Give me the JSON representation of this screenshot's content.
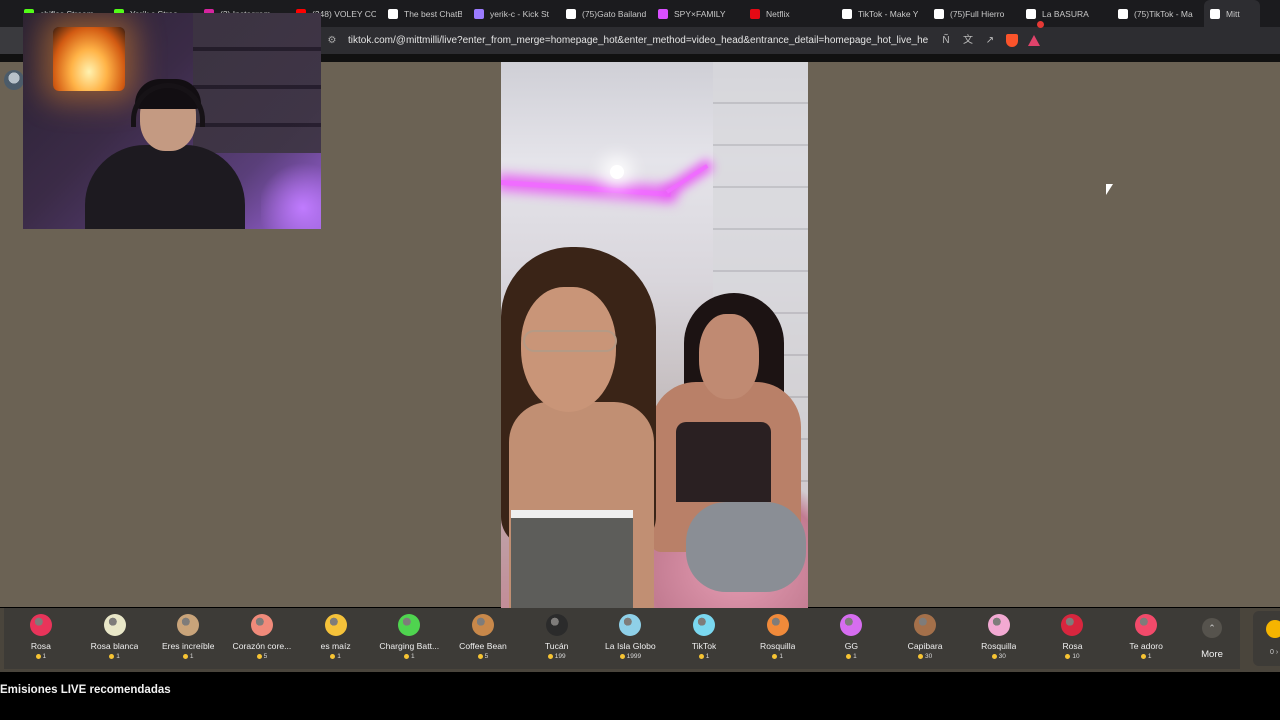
{
  "browser": {
    "tabs": [
      {
        "label": "chifles Stream -",
        "icon": "kick-icon",
        "color": "#53fc18"
      },
      {
        "label": "Yerik c Strea",
        "icon": "kick-icon",
        "color": "#53fc18"
      },
      {
        "label": "(3) Instagram",
        "icon": "instagram-icon",
        "color": "#d6249f"
      },
      {
        "label": "(348) VOLEY CO",
        "icon": "youtube-icon",
        "color": "#ff0000"
      },
      {
        "label": "The best ChatB",
        "icon": "chatbot-icon",
        "color": "#ffffff"
      },
      {
        "label": "yerik-c - Kick St",
        "icon": "kick-icon",
        "color": "#9b7bff"
      },
      {
        "label": "(75)Gato Bailand",
        "icon": "tiktok-icon",
        "color": "#ffffff"
      },
      {
        "label": "SPY×FAMILY",
        "icon": "anime-icon",
        "color": "#d94fff"
      },
      {
        "label": "Netflix",
        "icon": "netflix-icon",
        "color": "#e50914"
      },
      {
        "label": "TikTok - Make Y",
        "icon": "tiktok-icon",
        "color": "#ffffff"
      },
      {
        "label": "(75)Full Hierro",
        "icon": "tiktok-icon",
        "color": "#ffffff"
      },
      {
        "label": "La BASURA",
        "icon": "tiktok-icon",
        "color": "#ffffff"
      },
      {
        "label": "(75)TikTok - Ma",
        "icon": "tiktok-icon",
        "color": "#ffffff"
      },
      {
        "label": "Mitt",
        "icon": "tiktok-icon",
        "color": "#ffffff"
      }
    ],
    "url": "tiktok.com/@mittmilli/live?enter_from_merge=homepage_hot&enter_method=video_head&entrance_detail=homepage_hot_live_head&fr..."
  },
  "gifts": [
    {
      "name": "Rosa",
      "price": "1",
      "icon": "rose-icon",
      "color": "#e8345a"
    },
    {
      "name": "Rosa blanca",
      "price": "1",
      "icon": "white-rose-icon",
      "color": "#e9e7c8"
    },
    {
      "name": "Eres increíble",
      "price": "1",
      "icon": "cat-icon",
      "color": "#c9a47a"
    },
    {
      "name": "Corazón core...",
      "price": "5",
      "icon": "heart-hand-icon",
      "color": "#f08a7a"
    },
    {
      "name": "es maíz",
      "price": "1",
      "icon": "corn-icon",
      "color": "#f5c23a"
    },
    {
      "name": "Charging Batt...",
      "price": "1",
      "icon": "battery-icon",
      "color": "#4fd44f"
    },
    {
      "name": "Coffee Bean",
      "price": "5",
      "icon": "coffee-bean-icon",
      "color": "#c8884a"
    },
    {
      "name": "Tucán",
      "price": "199",
      "icon": "toucan-icon",
      "color": "#2b2b2b"
    },
    {
      "name": "La Isla Globo",
      "price": "1999",
      "icon": "balloon-island-icon",
      "color": "#8fd0e8"
    },
    {
      "name": "TikTok",
      "price": "1",
      "icon": "tiktok-icon",
      "color": "#7ad8f0"
    },
    {
      "name": "Rosquilla",
      "price": "1",
      "icon": "donut-icon",
      "color": "#f08a3a"
    },
    {
      "name": "GG",
      "price": "1",
      "icon": "gg-icon",
      "color": "#d66df0"
    },
    {
      "name": "Capibara",
      "price": "30",
      "icon": "capybara-icon",
      "color": "#a4704a"
    },
    {
      "name": "Rosquilla",
      "price": "30",
      "icon": "donut-pink-icon",
      "color": "#f2a9d2"
    },
    {
      "name": "Rosa",
      "price": "10",
      "icon": "rose-icon",
      "color": "#d8263e"
    },
    {
      "name": "Te adoro",
      "price": "1",
      "icon": "heart-icon",
      "color": "#f24a6a"
    }
  ],
  "more_label": "More",
  "side_count": "0 ›",
  "recommended_title": "Emisiones LIVE recomendadas"
}
